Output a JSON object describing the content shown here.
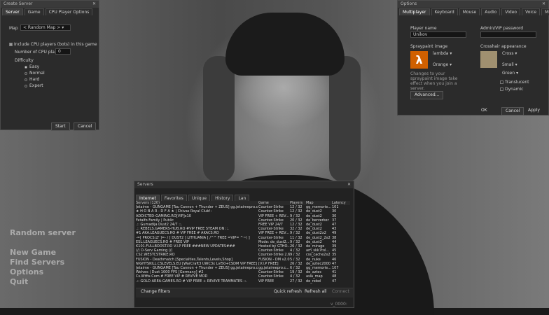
{
  "create_server": {
    "title": "Create Server",
    "tabs": [
      "Server",
      "Game",
      "CPU Player Options"
    ],
    "map_label": "Map",
    "map_value": "< Random Map >",
    "include_cpu": "Include CPU players (bots) in this game",
    "num_cpu_label": "Number of CPU pla...",
    "num_cpu_value": "0",
    "difficulty_label": "Difficulty",
    "difficulties": [
      "Easy",
      "Normal",
      "Hard",
      "Expert"
    ],
    "start": "Start",
    "cancel": "Cancel"
  },
  "options": {
    "title": "Options",
    "tabs": [
      "Multiplayer",
      "Keyboard",
      "Mouse",
      "Audio",
      "Video",
      "Voice",
      "Misc"
    ],
    "player_name_label": "Player name",
    "player_name_value": "Unikov",
    "admin_label": "Admin/VIP password",
    "spray_label": "Spraypaint image",
    "spray_value": "lambda",
    "spray_color": "Orange",
    "spray_note": "Changes to your spraypaint image take effect when you join a server.",
    "crosshair_label": "Crosshair appearance",
    "crosshair_type": "Cross",
    "crosshair_size": "Small",
    "crosshair_color": "Green",
    "translucent": "Translucent",
    "dynamic": "Dynamic",
    "advanced": "Advanced...",
    "ok": "OK",
    "cancel": "Cancel",
    "apply": "Apply"
  },
  "servers": {
    "title": "Servers",
    "tabs": [
      "Internet",
      "Favorites",
      "Unique",
      "History",
      "Lan"
    ],
    "headers": [
      "Servers (120)",
      "Game",
      "Players",
      "Map",
      "Latency"
    ],
    "rows": [
      [
        "Jetaime - GUNGAME [Tau Cannon + Thunder + ZEUS] gg.jetaimepro.c",
        "Counter-Strike",
        "12 / 32",
        "gg_memorie...",
        "101"
      ],
      [
        "★ H O B A R - D F A ★ | Chivas Royal Club!:",
        "Counter-Strike",
        "12 / 32",
        "de_dust2",
        "30"
      ],
      [
        "ADDICTED-GAMING.RO[VIP]x10",
        "VIP FREE + REV...",
        "9 / 32",
        "de_dust2",
        "30"
      ],
      [
        "Fatalfo Family | Public",
        "Counter-Strike",
        "20 / 32",
        "de_berzerker",
        "37"
      ],
      [
        ".:: Gumadija Dust2 24/7 ::.",
        "FREE VIP 24/7",
        "12 / 32",
        "de_dust2",
        "47"
      ],
      [
        ".:: REBELS.GAMERS-HUB.RO #VIP FREE STEAM ON ::.",
        "Counter-Strike",
        "32 / 32",
        "de_dust2",
        "43"
      ],
      [
        "#1 AKA.LEAGUECS.RO # VIP FREE # AKACS.RO",
        "VIP FREE + REV...",
        "9 / 32",
        "de_dust2x2",
        "49"
      ],
      [
        "-=[ PROCS.LT ]=- / [ DUST2 ] LITHUANIA [ /^^ FREE =VIP= ^~\\ ]",
        "Counter-Strike",
        "11 / 32",
        "de_dust2_2x2",
        "38"
      ],
      [
        "ESL.LEAGUECS.RO # FREE VIP",
        "Mode: de_dust2...",
        "9 / 32",
        "de_dust2",
        "44"
      ],
      [
        "K101.FULLBOOST.RO V.I.P FREE ###NEW UPDATES###",
        "Hosted by GTHO...",
        "26 / 32",
        "de_mirage",
        "39"
      ],
      [
        "(/) D-Serv Gaming (/)",
        "Counter-Strike",
        "4 / 32",
        "am_skk7tol...",
        "45"
      ],
      [
        "CS2.WESTCSTRIKE.RO",
        "Counter-Strike 2.6",
        "9 / 32",
        "css_cache2x2",
        "35"
      ],
      [
        "FUSION - Deathmatch [Specialties,Talents,Levels,Shop]",
        "FUSION - DM v2.0",
        "5 / 32",
        "de_nuke",
        "46"
      ],
      [
        "NIGHTSKILL.CSLEVELS.EU [WarCraft3 UWC3x LvI50+CSDM VIP FREE]",
        "[V.I.P FREE]",
        "26 / 32",
        "de_aztec2000",
        "47"
      ],
      [
        "Jetaime - GUNGAME [Tau Cannon + Thunder + ZEUS] gg.jetaimepro.c",
        "gg.jetaimepro.c...",
        "6 / 32",
        "gg_memorie...",
        "107"
      ],
      [
        "Wolves | Dust 1000 FPS [Germany] #2",
        "Counter-Strike",
        "19 / 32",
        "de_aztec",
        "41"
      ],
      [
        "Cs.Wtfix.Com # FREE VIP # REVIVE MOD",
        "Counter-Strike",
        "4 / 32",
        "asia_map",
        "48"
      ],
      [
        ".:: GOLD AREA-GAMES.RO # VIP FREE + REVIVE TEAMMATES ::.",
        "VIP FREE",
        "27 / 32",
        "de_rebel",
        "47"
      ]
    ],
    "change_filters": "Change filters",
    "quick_refresh": "Quick refresh",
    "refresh_all": "Refresh all",
    "connect": "Connect",
    "status": "v_0000:"
  },
  "main_menu": [
    "Random server",
    "New Game",
    "Find Servers",
    "Options",
    "Quit"
  ]
}
